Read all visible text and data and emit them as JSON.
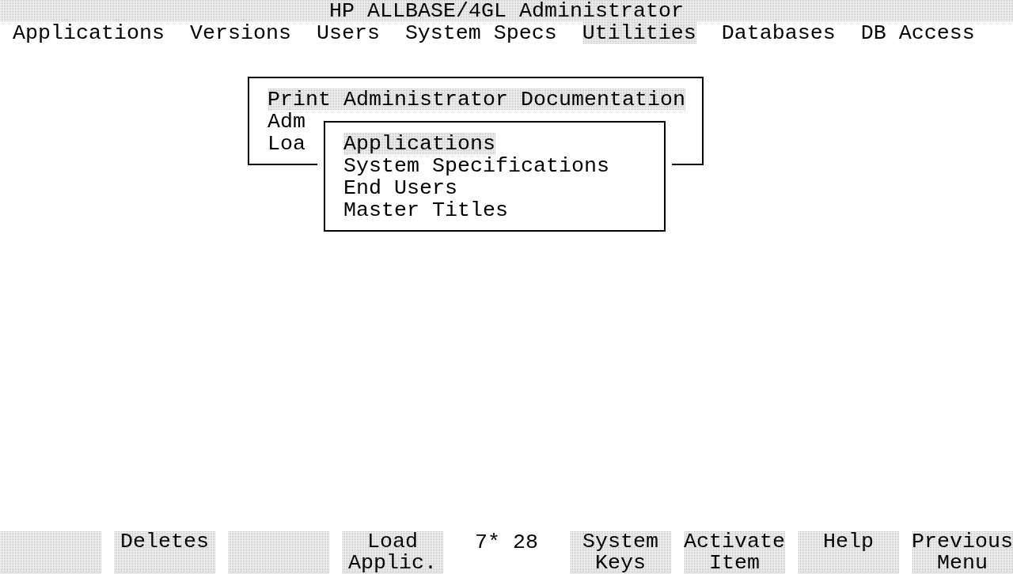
{
  "window": {
    "title": "HP ALLBASE/4GL Administrator"
  },
  "menu_bar": [
    {
      "label": "Applications",
      "selected": false
    },
    {
      "label": "Versions",
      "selected": false
    },
    {
      "label": "Users",
      "selected": false
    },
    {
      "label": "System Specs",
      "selected": false
    },
    {
      "label": "Utilities",
      "selected": true
    },
    {
      "label": "Databases",
      "selected": false
    },
    {
      "label": "DB Access",
      "selected": false
    }
  ],
  "menus": [
    {
      "items": [
        {
          "label": "Print Administrator Documentation",
          "selected": true
        },
        {
          "label": "Adm",
          "selected": false
        },
        {
          "label": "Loa",
          "selected": false
        }
      ]
    },
    {
      "items": [
        {
          "label": "Applications",
          "selected": true
        },
        {
          "label": "System Specifications",
          "selected": false
        },
        {
          "label": "End Users",
          "selected": false
        },
        {
          "label": "Master Titles",
          "selected": false
        }
      ]
    }
  ],
  "left_keys": [
    {
      "kind": "blank"
    },
    {
      "kind": "label",
      "lines": [
        "Deletes"
      ]
    },
    {
      "kind": "blank"
    },
    {
      "kind": "label",
      "lines": [
        "Load",
        "Applic."
      ]
    }
  ],
  "status_text": "7* 28",
  "right_keys": [
    {
      "kind": "label",
      "lines": [
        "System",
        "Keys"
      ]
    },
    {
      "kind": "label",
      "lines": [
        "Activate",
        "Item"
      ]
    },
    {
      "kind": "label",
      "lines": [
        "Help"
      ]
    },
    {
      "kind": "label",
      "lines": [
        "Previous",
        "Menu"
      ]
    }
  ]
}
